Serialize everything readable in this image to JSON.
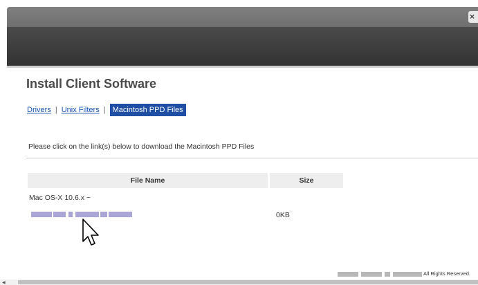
{
  "window": {
    "close_glyph": "×"
  },
  "page": {
    "title": "Install Client Software"
  },
  "tabs": [
    {
      "label": "Drivers",
      "active": false
    },
    {
      "label": "Unix Filters",
      "active": false
    },
    {
      "label": "Macintosh PPD Files",
      "active": true
    }
  ],
  "tab_separator": "|",
  "instructions": "Please click on the link(s) below to download the Macintosh PPD Files",
  "table": {
    "headers": [
      "File Name",
      "Size"
    ],
    "group": "Mac OS-X 10.6.x ~",
    "rows": [
      {
        "file_name": "",
        "size": "0KB"
      }
    ]
  },
  "footer": {
    "rights": "All Rights Reserved."
  },
  "icons": {
    "close": "close-icon",
    "pointer": "mouse-pointer-icon",
    "scroll_left": "scroll-left-arrow-icon"
  },
  "colors": {
    "active_tab": "#1f4fa5",
    "link": "#1a55b4",
    "header_band": "#3a3a3a"
  }
}
